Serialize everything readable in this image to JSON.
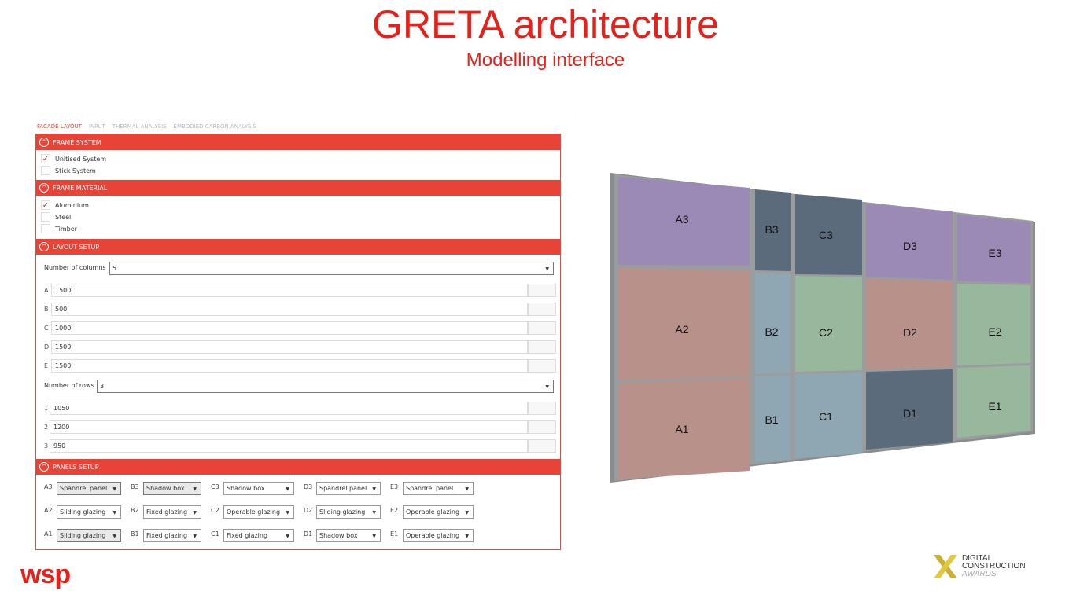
{
  "header": {
    "title": "GRETA architecture",
    "subtitle": "Modelling interface"
  },
  "tabs": [
    "FACADE LAYOUT",
    "INPUT",
    "THERMAL ANALYSIS",
    "EMBODIED CARBON ANALYSIS"
  ],
  "frame_system": {
    "title": "FRAME SYSTEM",
    "options": [
      {
        "label": "Unitised System",
        "checked": true
      },
      {
        "label": "Stick System",
        "checked": false
      }
    ]
  },
  "frame_material": {
    "title": "FRAME MATERIAL",
    "options": [
      {
        "label": "Aluminium",
        "checked": true
      },
      {
        "label": "Steel",
        "checked": false
      },
      {
        "label": "Timber",
        "checked": false
      }
    ]
  },
  "layout_setup": {
    "title": "LAYOUT SETUP",
    "columns_label": "Number of columns",
    "columns_value": "5",
    "columns": [
      {
        "key": "A",
        "value": "1500"
      },
      {
        "key": "B",
        "value": "500"
      },
      {
        "key": "C",
        "value": "1000"
      },
      {
        "key": "D",
        "value": "1500"
      },
      {
        "key": "E",
        "value": "1500"
      }
    ],
    "rows_label": "Number of rows",
    "rows_value": "3",
    "rows": [
      {
        "key": "1",
        "value": "1050"
      },
      {
        "key": "2",
        "value": "1200"
      },
      {
        "key": "3",
        "value": "950"
      }
    ]
  },
  "panels_setup": {
    "title": "PANELS SETUP",
    "rows": [
      [
        {
          "key": "A3",
          "value": "Spandrel panel"
        },
        {
          "key": "B3",
          "value": "Shadow box"
        },
        {
          "key": "C3",
          "value": "Shadow box"
        },
        {
          "key": "D3",
          "value": "Spandrel panel"
        },
        {
          "key": "E3",
          "value": "Spandrel panel"
        }
      ],
      [
        {
          "key": "A2",
          "value": "Sliding glazing"
        },
        {
          "key": "B2",
          "value": "Fixed glazing"
        },
        {
          "key": "C2",
          "value": "Operable glazing"
        },
        {
          "key": "D2",
          "value": "Sliding glazing"
        },
        {
          "key": "E2",
          "value": "Operable glazing"
        }
      ],
      [
        {
          "key": "A1",
          "value": "Sliding glazing"
        },
        {
          "key": "B1",
          "value": "Fixed glazing"
        },
        {
          "key": "C1",
          "value": "Fixed glazing"
        },
        {
          "key": "D1",
          "value": "Shadow box"
        },
        {
          "key": "E1",
          "value": "Operable glazing"
        }
      ]
    ]
  },
  "facade_panels": [
    {
      "label": "A3",
      "color": "#9b8ab5"
    },
    {
      "label": "B3",
      "color": "#5b6b7b"
    },
    {
      "label": "C3",
      "color": "#5b6b7b"
    },
    {
      "label": "D3",
      "color": "#9b8ab5"
    },
    {
      "label": "E3",
      "color": "#9b8ab5"
    },
    {
      "label": "A2",
      "color": "#b8918a"
    },
    {
      "label": "B2",
      "color": "#8fa6b3"
    },
    {
      "label": "C2",
      "color": "#98b89d"
    },
    {
      "label": "D2",
      "color": "#b8918a"
    },
    {
      "label": "E2",
      "color": "#98b89d"
    },
    {
      "label": "A1",
      "color": "#b8918a"
    },
    {
      "label": "B1",
      "color": "#8fa6b3"
    },
    {
      "label": "C1",
      "color": "#8fa6b3"
    },
    {
      "label": "D1",
      "color": "#5b6b7b"
    },
    {
      "label": "E1",
      "color": "#98b89d"
    }
  ],
  "logos": {
    "wsp": "wsp",
    "dca": [
      "DIGITAL",
      "CONSTRUCTION",
      "AWARDS"
    ]
  }
}
